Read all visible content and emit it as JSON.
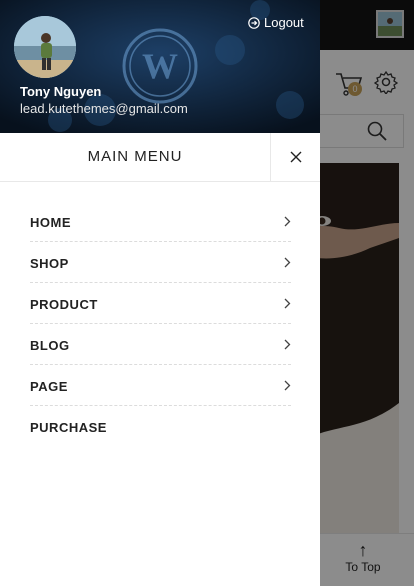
{
  "user": {
    "name": "Tony Nguyen",
    "email": "lead.kutethemes@gmail.com"
  },
  "logout_label": "Logout",
  "menu": {
    "title": "MAIN MENU",
    "items": [
      {
        "label": "HOME",
        "has_submenu": true
      },
      {
        "label": "SHOP",
        "has_submenu": true
      },
      {
        "label": "PRODUCT",
        "has_submenu": true
      },
      {
        "label": "BLOG",
        "has_submenu": true
      },
      {
        "label": "PAGE",
        "has_submenu": true
      },
      {
        "label": "PURCHASE",
        "has_submenu": false
      }
    ]
  },
  "background": {
    "cart_count": "0",
    "to_top_label": "To Top"
  },
  "icons": {
    "logout": "logout-icon",
    "close": "close-icon",
    "chevron": "chevron-right-icon",
    "cart": "cart-icon",
    "settings": "gear-icon",
    "search": "search-icon",
    "to_top": "arrow-up-icon"
  },
  "colors": {
    "drawer_header": "#0c1a2a",
    "badge": "#c8a35a",
    "overlay": "rgba(0,0,0,0.45)"
  }
}
